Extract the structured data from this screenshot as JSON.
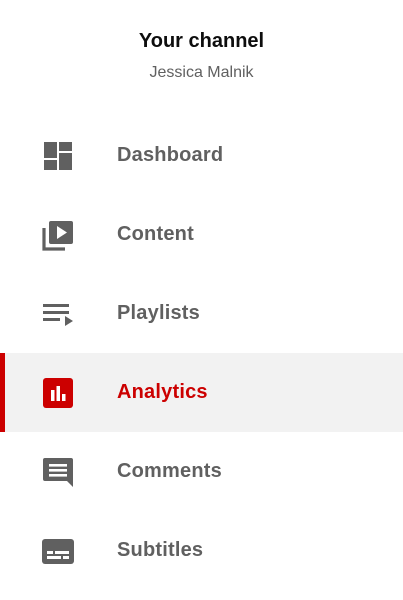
{
  "channel": {
    "title": "Your channel",
    "name": "Jessica Malnik"
  },
  "colors": {
    "accent": "#cc0000",
    "icon": "#606060",
    "active_background": "#f2f2f2"
  },
  "nav": {
    "items": [
      {
        "label": "Dashboard",
        "icon": "dashboard-icon",
        "active": false
      },
      {
        "label": "Content",
        "icon": "video-library-icon",
        "active": false
      },
      {
        "label": "Playlists",
        "icon": "playlist-icon",
        "active": false
      },
      {
        "label": "Analytics",
        "icon": "analytics-icon",
        "active": true
      },
      {
        "label": "Comments",
        "icon": "comment-icon",
        "active": false
      },
      {
        "label": "Subtitles",
        "icon": "subtitles-icon",
        "active": false
      }
    ]
  }
}
